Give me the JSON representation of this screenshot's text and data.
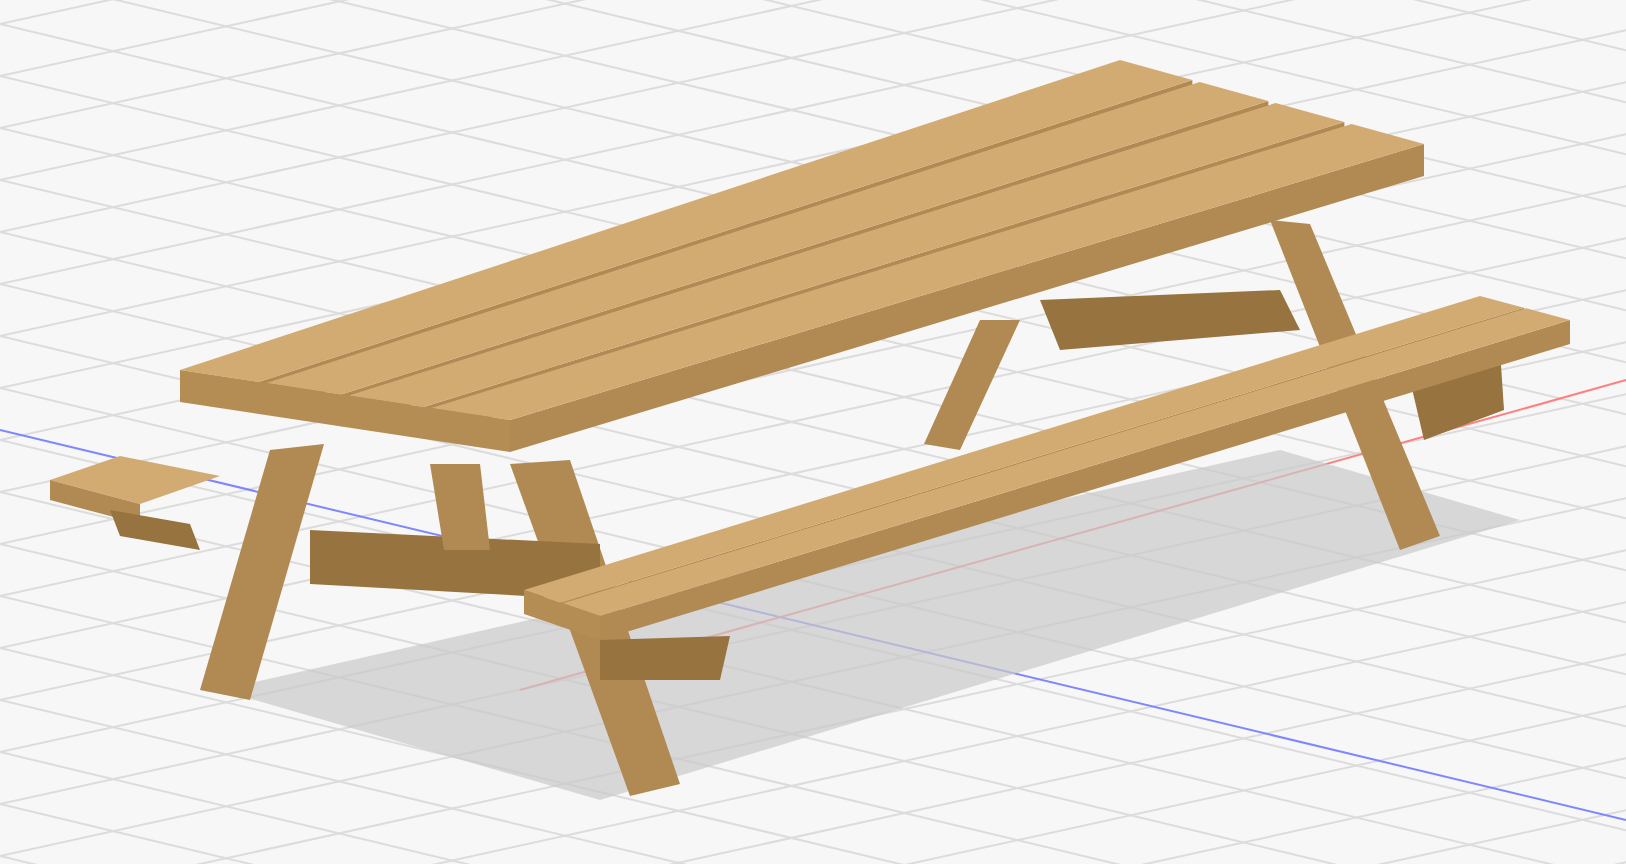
{
  "viewport": {
    "show_grid": true,
    "show_axes": true
  }
}
